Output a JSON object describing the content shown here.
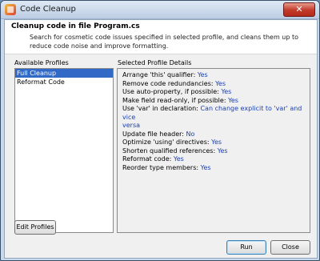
{
  "window": {
    "title": "Code Cleanup",
    "close_glyph": "✕"
  },
  "header": {
    "title": "Cleanup code in file Program.cs",
    "description": "Search for cosmetic code issues specified in selected profile, and cleans them up to reduce code noise and improve formatting."
  },
  "profiles": {
    "label": "Available Profiles",
    "items": [
      {
        "label": "Full Cleanup",
        "selected": true
      },
      {
        "label": "Reformat Code",
        "selected": false
      }
    ]
  },
  "details": {
    "label": "Selected Profile Details",
    "rows": [
      {
        "name": "Arrange 'this' qualifier: ",
        "value": "Yes"
      },
      {
        "name": "Remove code redundancies: ",
        "value": "Yes"
      },
      {
        "name": "Use auto-property, if possible: ",
        "value": "Yes"
      },
      {
        "name": "Make field read-only, if possible: ",
        "value": "Yes"
      },
      {
        "name": "Use 'var' in declaration: ",
        "value": "Can change explicit to 'var' and vice",
        "value_cont": "versa"
      },
      {
        "name": "Update file header: ",
        "value": "No"
      },
      {
        "name": "Optimize 'using' directives: ",
        "value": "Yes"
      },
      {
        "name": "Shorten qualified references: ",
        "value": "Yes"
      },
      {
        "name": "Reformat code: ",
        "value": "Yes"
      },
      {
        "name": "Reorder type members: ",
        "value": "Yes"
      }
    ]
  },
  "buttons": {
    "edit_profiles": "Edit Profiles",
    "run": "Run",
    "close": "Close"
  },
  "colors": {
    "selection": "#3169c6",
    "value_text": "#1a3fb0",
    "titlebar_close": "#c23a2a"
  }
}
